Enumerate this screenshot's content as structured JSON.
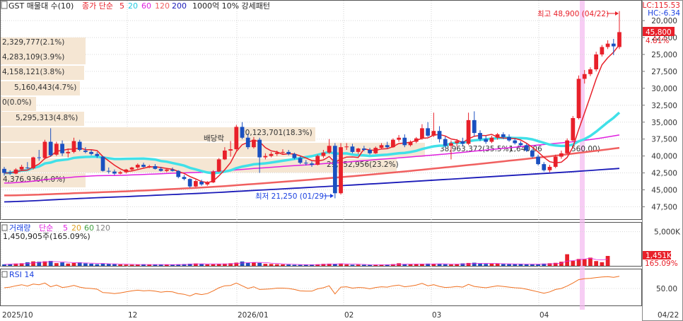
{
  "header": {
    "symbol": "GST 매물대 수(10)",
    "ma_label": "종가 단순",
    "ma_periods": [
      "5",
      "20",
      "60",
      "120",
      "200"
    ],
    "ma_colors": [
      "#e8202a",
      "#20c8e0",
      "#e020e0",
      "#f06060",
      "#1a1ab8"
    ],
    "extra": "1000억 10% 강세패턴"
  },
  "axis_labels": {
    "lc": "LC:115.53",
    "hc": "HC:-6.34",
    "price_ticks": [
      "47,500",
      "45,000",
      "42,500",
      "40,000",
      "37,500",
      "35,000",
      "32,500",
      "30,000",
      "27,500",
      "25,000",
      "22,500",
      "20,000"
    ],
    "current_price": "45,800",
    "current_change": "4.81%",
    "volume_ticks": [
      "5,000K"
    ],
    "current_volume": "1,451K",
    "volume_change": "165.09%",
    "rsi_ticks": [
      "50.00"
    ],
    "x_ticks": [
      "2025/10",
      "12",
      "2026/01",
      "02",
      "03",
      "04"
    ],
    "x_current": "04/22"
  },
  "volume_profile": [
    {
      "label": "2,329,777(2.1%)"
    },
    {
      "label": "4,283,109(3.9%)"
    },
    {
      "label": "4,158,121(3.8%)"
    },
    {
      "label": "5,160,443(4.7%)"
    },
    {
      "label": "0(0.0%)"
    },
    {
      "label": "5,295,313(4.8%)"
    },
    {
      "label": "20,123,701(18.3%)"
    },
    {
      "label": "29,652,956(23.2%)"
    },
    {
      "label": "4,376,936(4.0%)"
    },
    {
      "label": "38,963,372(35.5%)"
    },
    {
      "label": "1,640,06"
    },
    {
      "label": "560.00)"
    }
  ],
  "annotations": {
    "high": "최고 48,900 (04/22)",
    "low": "최저 21,250 (01/29)",
    "dividend": "배당락"
  },
  "volume_panel": {
    "title": "거래량",
    "ma_label": "단순",
    "ma_periods": [
      "5",
      "20",
      "60",
      "120"
    ],
    "ma_colors": [
      "#e020e0",
      "#e0a020",
      "#40a040",
      "#808080"
    ],
    "value": "1,450,905주(165.09%)"
  },
  "rsi_panel": {
    "title": "RSI 14"
  },
  "chart_data": [
    {
      "type": "candlestick",
      "title": "GST",
      "ylim": [
        19000,
        49500
      ],
      "y_ticks": [
        20000,
        22500,
        25000,
        27500,
        30000,
        32500,
        35000,
        37500,
        40000,
        42500,
        45000,
        47500
      ],
      "x_ticks": [
        "2025/10",
        "12",
        "2026/01",
        "02",
        "03",
        "04"
      ],
      "grid": true,
      "candles": [
        {
          "o": 25600,
          "h": 25900,
          "l": 24600,
          "c": 25000
        },
        {
          "o": 25100,
          "h": 25400,
          "l": 24700,
          "c": 25000
        },
        {
          "o": 24900,
          "h": 25700,
          "l": 24800,
          "c": 25500
        },
        {
          "o": 25500,
          "h": 26200,
          "l": 25300,
          "c": 25900
        },
        {
          "o": 25800,
          "h": 26600,
          "l": 25600,
          "c": 25700
        },
        {
          "o": 25700,
          "h": 27400,
          "l": 25500,
          "c": 27300
        },
        {
          "o": 27300,
          "h": 28400,
          "l": 26800,
          "c": 27200
        },
        {
          "o": 27200,
          "h": 29900,
          "l": 27000,
          "c": 29600
        },
        {
          "o": 29600,
          "h": 31600,
          "l": 27400,
          "c": 27600
        },
        {
          "o": 27700,
          "h": 29600,
          "l": 27500,
          "c": 29300
        },
        {
          "o": 29300,
          "h": 29800,
          "l": 27500,
          "c": 27900
        },
        {
          "o": 27900,
          "h": 28600,
          "l": 27300,
          "c": 28100
        },
        {
          "o": 28100,
          "h": 30200,
          "l": 27900,
          "c": 29700
        },
        {
          "o": 29600,
          "h": 29900,
          "l": 28200,
          "c": 28400
        },
        {
          "o": 28300,
          "h": 28800,
          "l": 27900,
          "c": 28100
        },
        {
          "o": 28100,
          "h": 28400,
          "l": 27600,
          "c": 27800
        },
        {
          "o": 27800,
          "h": 28100,
          "l": 27200,
          "c": 27500
        },
        {
          "o": 27400,
          "h": 27500,
          "l": 25200,
          "c": 25300
        },
        {
          "o": 25300,
          "h": 25800,
          "l": 24900,
          "c": 25200
        },
        {
          "o": 25200,
          "h": 25500,
          "l": 24700,
          "c": 24900
        },
        {
          "o": 24900,
          "h": 25300,
          "l": 24800,
          "c": 25100
        },
        {
          "o": 25100,
          "h": 25600,
          "l": 24900,
          "c": 25500
        },
        {
          "o": 25500,
          "h": 25900,
          "l": 25300,
          "c": 25800
        },
        {
          "o": 25800,
          "h": 26400,
          "l": 25600,
          "c": 26200
        },
        {
          "o": 26200,
          "h": 26500,
          "l": 25800,
          "c": 25900
        },
        {
          "o": 25900,
          "h": 26200,
          "l": 25700,
          "c": 26000
        },
        {
          "o": 26000,
          "h": 26300,
          "l": 25500,
          "c": 25600
        },
        {
          "o": 25600,
          "h": 25900,
          "l": 25200,
          "c": 25300
        },
        {
          "o": 25300,
          "h": 25700,
          "l": 25100,
          "c": 25500
        },
        {
          "o": 25500,
          "h": 25800,
          "l": 25200,
          "c": 25300
        },
        {
          "o": 25300,
          "h": 25400,
          "l": 24200,
          "c": 24400
        },
        {
          "o": 24400,
          "h": 24700,
          "l": 23900,
          "c": 24100
        },
        {
          "o": 24100,
          "h": 24200,
          "l": 22800,
          "c": 23000
        },
        {
          "o": 23000,
          "h": 24000,
          "l": 22900,
          "c": 23800
        },
        {
          "o": 23700,
          "h": 24000,
          "l": 23100,
          "c": 23300
        },
        {
          "o": 23300,
          "h": 23800,
          "l": 23100,
          "c": 23600
        },
        {
          "o": 23600,
          "h": 25400,
          "l": 23500,
          "c": 25200
        },
        {
          "o": 25200,
          "h": 27200,
          "l": 25100,
          "c": 27000
        },
        {
          "o": 27000,
          "h": 28800,
          "l": 26900,
          "c": 28300
        },
        {
          "o": 28300,
          "h": 29700,
          "l": 27400,
          "c": 28500
        },
        {
          "o": 28500,
          "h": 32100,
          "l": 28300,
          "c": 31800
        },
        {
          "o": 31800,
          "h": 32500,
          "l": 30000,
          "c": 30200
        },
        {
          "o": 30200,
          "h": 30800,
          "l": 28500,
          "c": 28800
        },
        {
          "o": 28800,
          "h": 30300,
          "l": 28600,
          "c": 29900
        },
        {
          "o": 29900,
          "h": 30200,
          "l": 25000,
          "c": 27300
        },
        {
          "o": 27300,
          "h": 27900,
          "l": 27000,
          "c": 27500
        },
        {
          "o": 27500,
          "h": 28100,
          "l": 27300,
          "c": 27800
        },
        {
          "o": 27800,
          "h": 28300,
          "l": 27500,
          "c": 28000
        },
        {
          "o": 28000,
          "h": 28500,
          "l": 27700,
          "c": 28100
        },
        {
          "o": 28100,
          "h": 28400,
          "l": 27600,
          "c": 27800
        },
        {
          "o": 27800,
          "h": 28000,
          "l": 27000,
          "c": 27200
        },
        {
          "o": 27200,
          "h": 27500,
          "l": 26300,
          "c": 26500
        },
        {
          "o": 26500,
          "h": 26900,
          "l": 26100,
          "c": 26400
        },
        {
          "o": 26400,
          "h": 26700,
          "l": 25900,
          "c": 26200
        },
        {
          "o": 26200,
          "h": 27700,
          "l": 26100,
          "c": 27500
        },
        {
          "o": 27500,
          "h": 28400,
          "l": 27200,
          "c": 28000
        },
        {
          "o": 28000,
          "h": 30000,
          "l": 27800,
          "c": 29000
        },
        {
          "o": 29000,
          "h": 29400,
          "l": 21250,
          "c": 22000
        },
        {
          "o": 22000,
          "h": 29400,
          "l": 21800,
          "c": 28800
        },
        {
          "o": 28800,
          "h": 29400,
          "l": 28400,
          "c": 28900
        },
        {
          "o": 28900,
          "h": 29300,
          "l": 27900,
          "c": 28100
        },
        {
          "o": 28100,
          "h": 28700,
          "l": 27800,
          "c": 28600
        },
        {
          "o": 28600,
          "h": 29000,
          "l": 28200,
          "c": 28400
        },
        {
          "o": 28400,
          "h": 28700,
          "l": 27700,
          "c": 27900
        },
        {
          "o": 27900,
          "h": 28900,
          "l": 27800,
          "c": 28700
        },
        {
          "o": 28700,
          "h": 29400,
          "l": 28500,
          "c": 29100
        },
        {
          "o": 29100,
          "h": 29600,
          "l": 28600,
          "c": 28800
        },
        {
          "o": 28800,
          "h": 30100,
          "l": 28700,
          "c": 29900
        },
        {
          "o": 29900,
          "h": 30600,
          "l": 29600,
          "c": 30200
        },
        {
          "o": 30200,
          "h": 30700,
          "l": 28800,
          "c": 29100
        },
        {
          "o": 29100,
          "h": 29800,
          "l": 28900,
          "c": 29600
        },
        {
          "o": 29600,
          "h": 30300,
          "l": 29400,
          "c": 30100
        },
        {
          "o": 30100,
          "h": 32200,
          "l": 29900,
          "c": 31600
        },
        {
          "o": 31600,
          "h": 32500,
          "l": 30300,
          "c": 30500
        },
        {
          "o": 30500,
          "h": 33900,
          "l": 30300,
          "c": 31200
        },
        {
          "o": 31200,
          "h": 31900,
          "l": 29500,
          "c": 30000
        },
        {
          "o": 30000,
          "h": 30400,
          "l": 28700,
          "c": 29000
        },
        {
          "o": 29000,
          "h": 29800,
          "l": 27000,
          "c": 29400
        },
        {
          "o": 29400,
          "h": 30000,
          "l": 28900,
          "c": 29700
        },
        {
          "o": 29700,
          "h": 30200,
          "l": 29000,
          "c": 29300
        },
        {
          "o": 29300,
          "h": 33900,
          "l": 29100,
          "c": 32800
        },
        {
          "o": 32800,
          "h": 34100,
          "l": 30400,
          "c": 30900
        },
        {
          "o": 30900,
          "h": 31300,
          "l": 29700,
          "c": 30000
        },
        {
          "o": 30000,
          "h": 30500,
          "l": 29300,
          "c": 29600
        },
        {
          "o": 29600,
          "h": 30500,
          "l": 29400,
          "c": 30200
        },
        {
          "o": 30200,
          "h": 30900,
          "l": 29900,
          "c": 30700
        },
        {
          "o": 30700,
          "h": 31000,
          "l": 30000,
          "c": 30300
        },
        {
          "o": 30300,
          "h": 30700,
          "l": 29600,
          "c": 29800
        },
        {
          "o": 29800,
          "h": 30100,
          "l": 29200,
          "c": 29400
        },
        {
          "o": 29400,
          "h": 29700,
          "l": 28900,
          "c": 29100
        },
        {
          "o": 29100,
          "h": 29300,
          "l": 28100,
          "c": 28300
        },
        {
          "o": 28300,
          "h": 28600,
          "l": 27200,
          "c": 27400
        },
        {
          "o": 27400,
          "h": 27700,
          "l": 26100,
          "c": 26300
        },
        {
          "o": 26300,
          "h": 26600,
          "l": 25200,
          "c": 25400
        },
        {
          "o": 25400,
          "h": 26200,
          "l": 25100,
          "c": 25900
        },
        {
          "o": 25900,
          "h": 27700,
          "l": 25700,
          "c": 27400
        },
        {
          "o": 27400,
          "h": 28300,
          "l": 27100,
          "c": 27900
        },
        {
          "o": 27900,
          "h": 30100,
          "l": 27700,
          "c": 29800
        },
        {
          "o": 29800,
          "h": 33400,
          "l": 29600,
          "c": 33100
        },
        {
          "o": 33100,
          "h": 39400,
          "l": 32900,
          "c": 38900
        },
        {
          "o": 38900,
          "h": 40200,
          "l": 38200,
          "c": 39600
        },
        {
          "o": 39600,
          "h": 40600,
          "l": 39300,
          "c": 40300
        },
        {
          "o": 40300,
          "h": 42900,
          "l": 40000,
          "c": 42500
        },
        {
          "o": 42500,
          "h": 43900,
          "l": 42200,
          "c": 43600
        },
        {
          "o": 43600,
          "h": 44600,
          "l": 43300,
          "c": 44100
        },
        {
          "o": 44100,
          "h": 44800,
          "l": 42400,
          "c": 43700
        },
        {
          "o": 43600,
          "h": 48900,
          "l": 43300,
          "c": 45800
        }
      ],
      "ma_lines": [
        {
          "period": 5,
          "color": "#e8202a"
        },
        {
          "period": 20,
          "color": "#20c8e0"
        },
        {
          "period": 60,
          "color": "#e020e0"
        },
        {
          "period": 120,
          "color": "#f06060"
        },
        {
          "period": 200,
          "color": "#1a1ab8"
        }
      ]
    },
    {
      "type": "bar",
      "title": "거래량",
      "ylim": [
        0,
        6000
      ],
      "y_ticks": [
        5000
      ],
      "unit": "K",
      "values": [
        210,
        270,
        340,
        380,
        520,
        650,
        600,
        660,
        720,
        400,
        500,
        330,
        420,
        510,
        370,
        310,
        250,
        330,
        300,
        240,
        200,
        180,
        170,
        200,
        230,
        210,
        180,
        170,
        160,
        180,
        220,
        260,
        310,
        350,
        290,
        210,
        230,
        300,
        330,
        380,
        470,
        640,
        470,
        520,
        430,
        300,
        280,
        240,
        210,
        190,
        150,
        140,
        160,
        200,
        230,
        290,
        320,
        280,
        340,
        210,
        160,
        180,
        150,
        140,
        150,
        170,
        190,
        250,
        380,
        220,
        230,
        240,
        290,
        330,
        310,
        300,
        230,
        200,
        240,
        360,
        420,
        460,
        330,
        290,
        310,
        330,
        270,
        250,
        240,
        270,
        230,
        210,
        230,
        330,
        380,
        440,
        600,
        1700,
        720,
        1000,
        960,
        1200,
        700,
        540,
        1451
      ],
      "up_color": "#e8202a",
      "down_color": "#2050c0"
    },
    {
      "type": "line",
      "title": "RSI 14",
      "ylim": [
        0,
        100
      ],
      "y_ticks": [
        50
      ],
      "values": [
        52,
        54,
        58,
        61,
        57,
        63,
        61,
        66,
        55,
        60,
        53,
        55,
        59,
        54,
        51,
        50,
        48,
        38,
        37,
        35,
        37,
        40,
        43,
        45,
        43,
        44,
        42,
        39,
        41,
        40,
        35,
        33,
        28,
        35,
        32,
        35,
        43,
        52,
        58,
        59,
        66,
        58,
        50,
        55,
        47,
        48,
        49,
        51,
        51,
        50,
        47,
        43,
        42,
        42,
        49,
        52,
        58,
        34,
        54,
        55,
        51,
        53,
        52,
        49,
        53,
        55,
        54,
        58,
        60,
        55,
        57,
        60,
        65,
        58,
        61,
        56,
        53,
        54,
        56,
        54,
        62,
        56,
        54,
        52,
        55,
        58,
        56,
        54,
        52,
        51,
        48,
        44,
        40,
        36,
        40,
        47,
        50,
        57,
        66,
        76,
        79,
        80,
        82,
        84,
        85,
        83,
        86
      ]
    }
  ]
}
